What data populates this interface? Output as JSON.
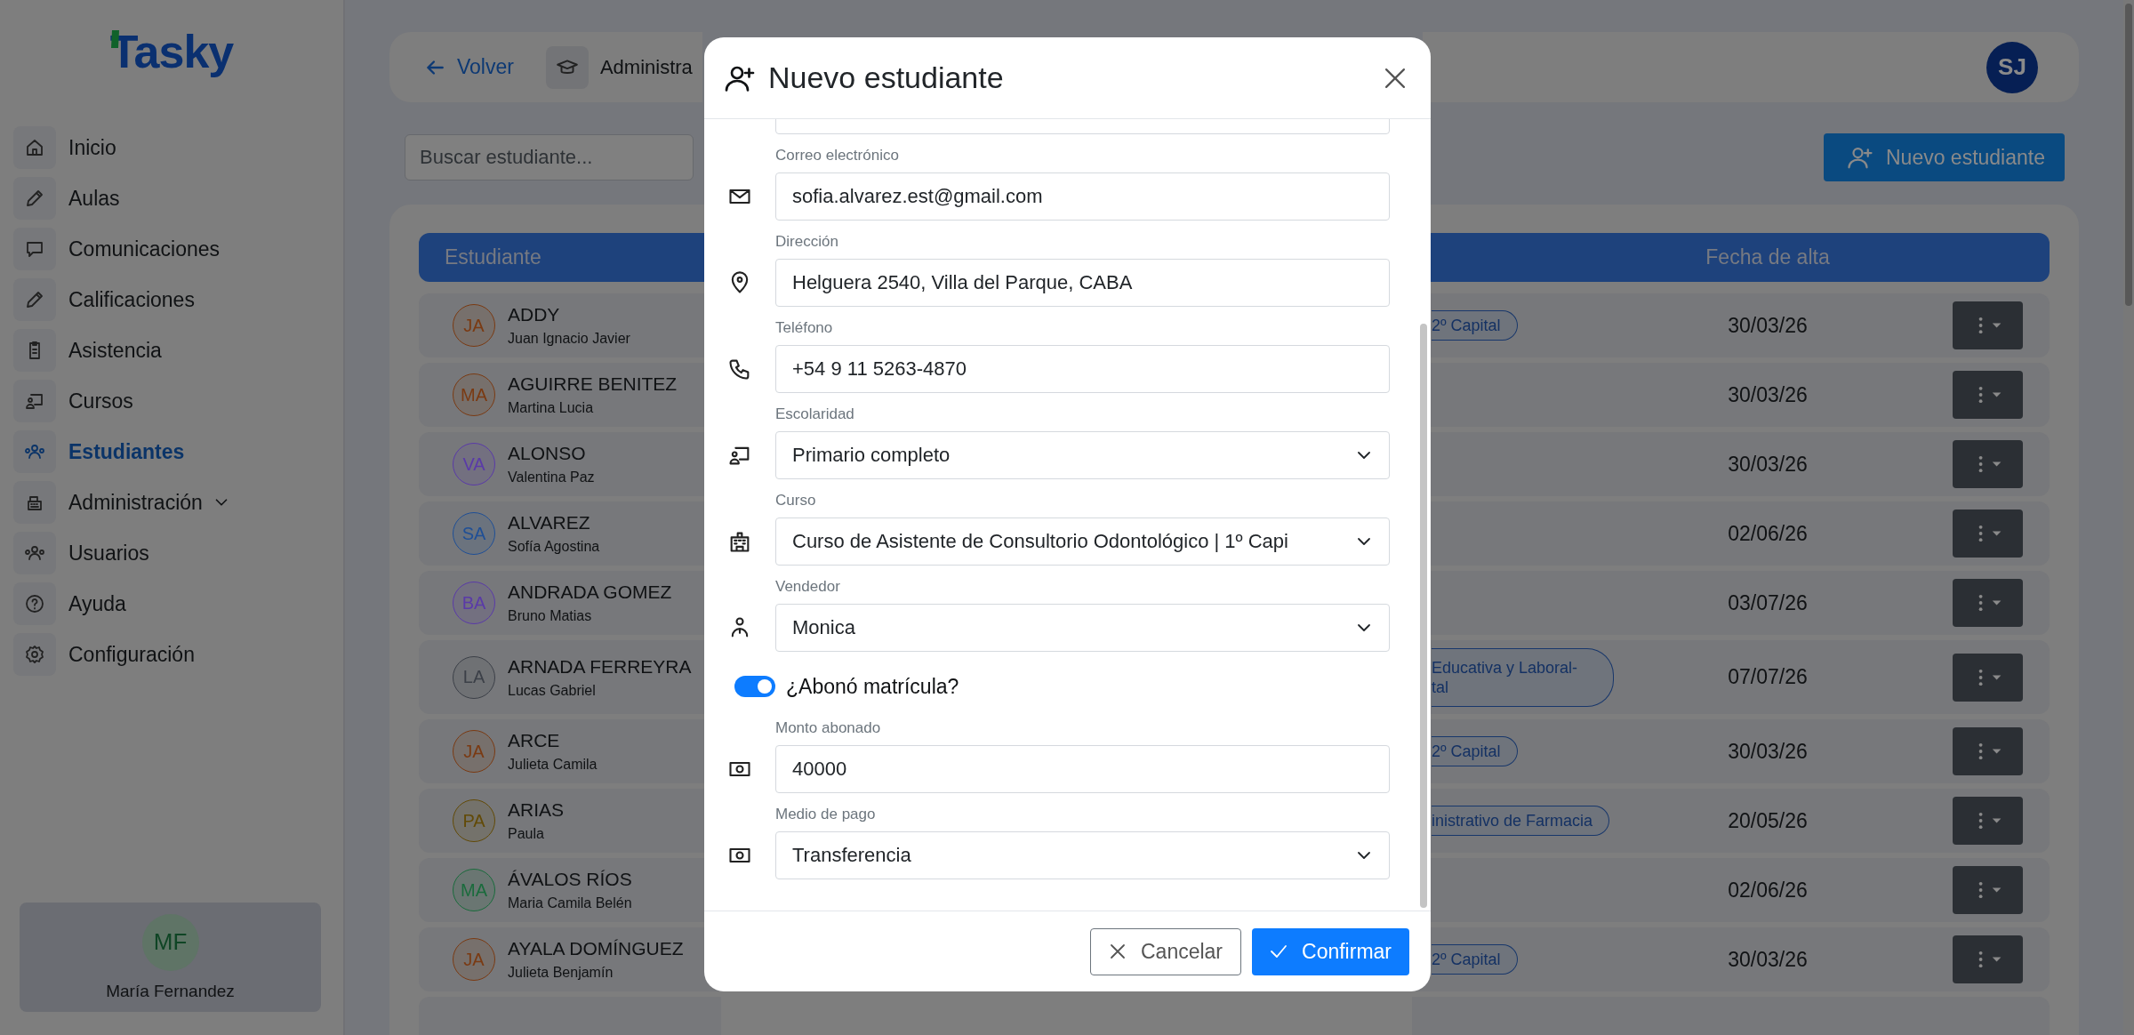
{
  "sidebar": {
    "logo": "Tasky",
    "items": [
      {
        "label": "Inicio",
        "selected": false,
        "expandable": false
      },
      {
        "label": "Aulas",
        "selected": false,
        "expandable": false
      },
      {
        "label": "Comunicaciones",
        "selected": false,
        "expandable": false
      },
      {
        "label": "Calificaciones",
        "selected": false,
        "expandable": false
      },
      {
        "label": "Asistencia",
        "selected": false,
        "expandable": false
      },
      {
        "label": "Cursos",
        "selected": false,
        "expandable": false
      },
      {
        "label": "Estudiantes",
        "selected": true,
        "expandable": false
      },
      {
        "label": "Administración",
        "selected": false,
        "expandable": true
      },
      {
        "label": "Usuarios",
        "selected": false,
        "expandable": false
      },
      {
        "label": "Ayuda",
        "selected": false,
        "expandable": false
      },
      {
        "label": "Configuración",
        "selected": false,
        "expandable": false
      }
    ],
    "user": {
      "initials": "MF",
      "name": "María Fernandez"
    }
  },
  "header": {
    "back": "Volver",
    "section": "Administra",
    "avatar": "SJ"
  },
  "search": {
    "placeholder": "Buscar estudiante..."
  },
  "new_button": "Nuevo estudiante",
  "table": {
    "columns": [
      "Estudiante",
      "Fecha de alta"
    ],
    "rows": [
      {
        "initials": "JA",
        "color": "#7a3a12",
        "surname": "ADDY",
        "given": "Juan Ignacio Javier",
        "tag": [
          "2º Capital"
        ],
        "date": "30/03/26"
      },
      {
        "initials": "MA",
        "color": "#7a3a12",
        "surname": "AGUIRRE BENITEZ",
        "given": "Martina Lucia",
        "date": "30/03/26"
      },
      {
        "initials": "VA",
        "color": "#5a3aa8",
        "surname": "ALONSO",
        "given": "Valentina Paz",
        "date": "30/03/26"
      },
      {
        "initials": "SA",
        "color": "#1f4f96",
        "surname": "ALVAREZ",
        "given": "Sofía Agostina",
        "date": "02/06/26"
      },
      {
        "initials": "BA",
        "color": "#5a3aa8",
        "surname": "ANDRADA GOMEZ",
        "given": "Bruno Matias",
        "date": "03/07/26"
      },
      {
        "initials": "LA",
        "color": "#3c4048",
        "surname": "ARNADA FERREYRA",
        "given": "Lucas Gabriel",
        "tag": [
          "Educativa y Laboral-",
          "tal"
        ],
        "date": "07/07/26"
      },
      {
        "initials": "JA",
        "color": "#7a3a12",
        "surname": "ARCE",
        "given": "Julieta Camila",
        "tag": [
          "2º Capital"
        ],
        "date": "30/03/26"
      },
      {
        "initials": "PA",
        "color": "#624a06",
        "surname": "ARIAS",
        "given": "Paula",
        "tag": [
          "inistrativo de Farmacia"
        ],
        "date": "20/05/26"
      },
      {
        "initials": "MA",
        "color": "#1a6b3c",
        "surname": "ÁVALOS RÍOS",
        "given": "Maria Camila Belén",
        "date": "02/06/26"
      },
      {
        "initials": "JA",
        "color": "#7a3a12",
        "surname": "AYALA DOMÍNGUEZ",
        "given": "Julieta Benjamín",
        "tag": [
          "2º Capital"
        ],
        "date": "30/03/26"
      }
    ]
  },
  "modal": {
    "title": "Nuevo estudiante",
    "fields": [
      {
        "kind": "input"
      },
      {
        "kind": "input",
        "label": "Correo electrónico",
        "value": "sofia.alvarez.est@gmail.com"
      },
      {
        "kind": "input",
        "label": "Dirección",
        "value": "Helguera 2540, Villa del Parque, CABA"
      },
      {
        "kind": "input",
        "label": "Teléfono",
        "value": "+54 9 11 5263-4870"
      },
      {
        "kind": "select",
        "label": "Escolaridad",
        "value": "Primario completo"
      },
      {
        "kind": "select",
        "label": "Curso",
        "value": "Curso de Asistente de Consultorio Odontológico | 1º Capi"
      },
      {
        "kind": "select",
        "label": "Vendedor",
        "value": "Monica"
      },
      {
        "kind": "toggle",
        "label": "¿Abonó matrícula?",
        "on": true
      },
      {
        "kind": "input",
        "label": "Monto abonado",
        "value": "40000"
      },
      {
        "kind": "select",
        "label": "Medio de pago",
        "value": "Transferencia"
      }
    ],
    "cancel": "Cancelar",
    "confirm": "Confirmar"
  }
}
